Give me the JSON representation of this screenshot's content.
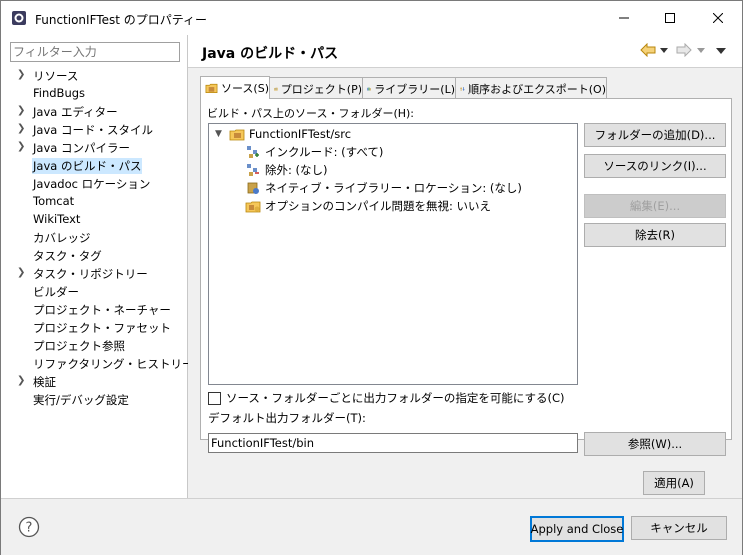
{
  "window": {
    "title": "FunctionIFTest のプロパティー"
  },
  "sidebar": {
    "filter_placeholder": "フィルター入力",
    "items": [
      {
        "label": "リソース",
        "expandable": true
      },
      {
        "label": "FindBugs",
        "expandable": false
      },
      {
        "label": "Java エディター",
        "expandable": true
      },
      {
        "label": "Java コード・スタイル",
        "expandable": true
      },
      {
        "label": "Java コンパイラー",
        "expandable": true
      },
      {
        "label": "Java のビルド・パス",
        "expandable": false,
        "selected": true
      },
      {
        "label": "Javadoc ロケーション",
        "expandable": false
      },
      {
        "label": "Tomcat",
        "expandable": false
      },
      {
        "label": "WikiText",
        "expandable": false
      },
      {
        "label": "カバレッジ",
        "expandable": false
      },
      {
        "label": "タスク・タグ",
        "expandable": false
      },
      {
        "label": "タスク・リポジトリー",
        "expandable": true
      },
      {
        "label": "ビルダー",
        "expandable": false
      },
      {
        "label": "プロジェクト・ネーチャー",
        "expandable": false
      },
      {
        "label": "プロジェクト・ファセット",
        "expandable": false
      },
      {
        "label": "プロジェクト参照",
        "expandable": false
      },
      {
        "label": "リファクタリング・ヒストリー",
        "expandable": false
      },
      {
        "label": "検証",
        "expandable": true
      },
      {
        "label": "実行/デバッグ設定",
        "expandable": false
      }
    ]
  },
  "main": {
    "title": "Java のビルド・パス",
    "tabs": [
      {
        "label": "ソース(S)",
        "icon": "source-folder-icon",
        "active": true
      },
      {
        "label": "プロジェクト(P)",
        "icon": "project-folder-icon",
        "active": false
      },
      {
        "label": "ライブラリー(L)",
        "icon": "library-icon",
        "active": false
      },
      {
        "label": "順序およびエクスポート(O)",
        "icon": "order-export-icon",
        "active": false
      }
    ],
    "source_section_label": "ビルド・パス上のソース・フォルダー(H):",
    "tree": {
      "root": "FunctionIFTest/src",
      "children": [
        {
          "label": "インクルード: (すべて)",
          "icon": "include-filter-icon"
        },
        {
          "label": "除外: (なし)",
          "icon": "exclude-filter-icon"
        },
        {
          "label": "ネイティブ・ライブラリー・ロケーション: (なし)",
          "icon": "native-library-icon"
        },
        {
          "label": "オプションのコンパイル問題を無視: いいえ",
          "icon": "compile-problems-icon"
        }
      ]
    },
    "buttons": {
      "add_folder": "フォルダーの追加(D)...",
      "link_source": "ソースのリンク(I)...",
      "edit": "編集(E)...",
      "remove": "除去(R)",
      "browse": "参照(W)...",
      "apply": "適用(A)"
    },
    "checkbox_label": "ソース・フォルダーごとに出力フォルダーの指定を可能にする(C)",
    "checkbox_checked": false,
    "output_folder_label": "デフォルト出力フォルダー(T):",
    "output_folder_value": "FunctionIFTest/bin"
  },
  "footer": {
    "apply_close": "Apply and Close",
    "cancel": "キャンセル"
  },
  "colors": {
    "selection": "#cce8ff",
    "primary_border": "#0078d7",
    "button_bg": "#e1e1e1",
    "panel_bg": "#f0f0f0"
  }
}
